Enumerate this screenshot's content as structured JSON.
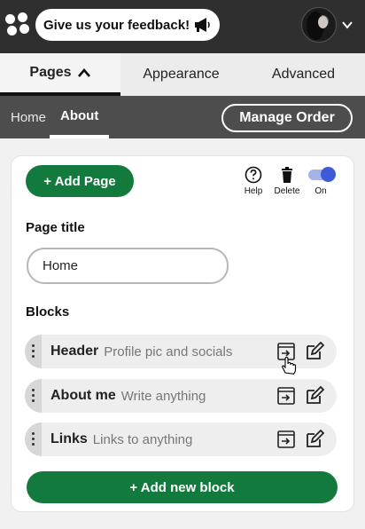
{
  "topbar": {
    "logo_icon": "paw-logo-icon",
    "feedback_label": "Give us your feedback!",
    "feedback_icon": "megaphone-icon",
    "avatar_icon": "profile-avatar",
    "menu_icon": "chevron-down-icon"
  },
  "tabs": {
    "pages": "Pages",
    "appearance": "Appearance",
    "advanced": "Advanced"
  },
  "subnav": {
    "home": "Home",
    "about": "About",
    "manage_order": "Manage Order"
  },
  "toolbar": {
    "add_page": "+ Add Page",
    "help": "Help",
    "delete": "Delete",
    "on": "On",
    "toggle_on": true
  },
  "form": {
    "page_title_label": "Page title",
    "page_title_value": "Home",
    "blocks_label": "Blocks"
  },
  "blocks": [
    {
      "name": "Header",
      "desc": "Profile pic and socials"
    },
    {
      "name": "About me",
      "desc": "Write anything"
    },
    {
      "name": "Links",
      "desc": "Links to anything"
    }
  ],
  "add_block": "+ Add new block",
  "colors": {
    "topbar": "#2f2f2f",
    "primary_green": "#137a3e",
    "subnav": "#4d4d4d",
    "toggle_blue": "#3e5ad7"
  }
}
